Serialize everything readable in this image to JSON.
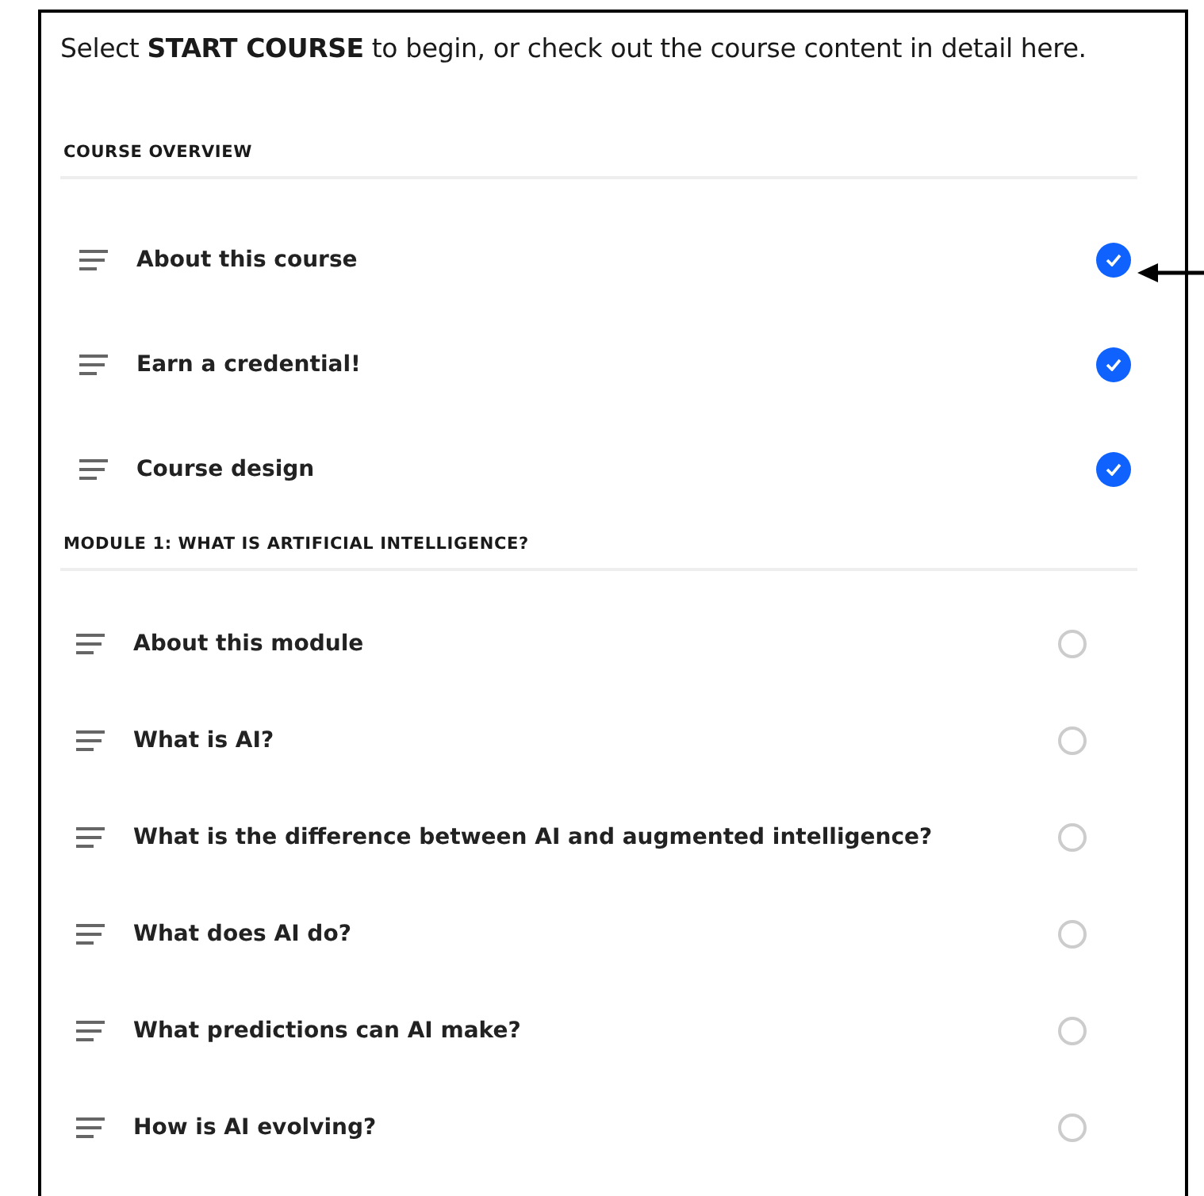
{
  "intro": "Select **START COURSE** to begin, or check out the course content in detail here.",
  "sections": [
    {
      "title": "COURSE OVERVIEW",
      "items": [
        {
          "label": "About this course",
          "completed": true
        },
        {
          "label": "Earn a credential!",
          "completed": true
        },
        {
          "label": "Course design",
          "completed": true
        }
      ]
    },
    {
      "title": "MODULE 1: WHAT IS ARTIFICIAL INTELLIGENCE?",
      "items": [
        {
          "label": "About this module",
          "completed": false
        },
        {
          "label": "What is AI?",
          "completed": false
        },
        {
          "label": "What is the difference between AI and augmented intelligence?",
          "completed": false
        },
        {
          "label": "What does AI do?",
          "completed": false
        },
        {
          "label": "What predictions can AI make?",
          "completed": false
        },
        {
          "label": "How is AI evolving?",
          "completed": false
        }
      ]
    }
  ]
}
